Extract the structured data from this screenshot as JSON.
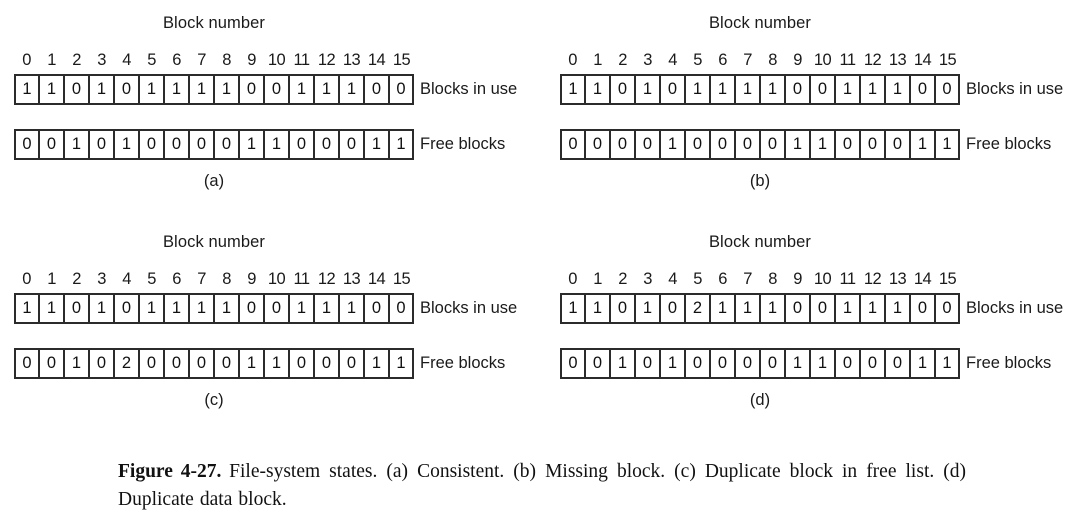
{
  "figure": {
    "caption_number": "Figure 4-27.",
    "caption_text": "File-system states.  (a) Consistent.  (b) Missing block.  (c) Duplicate block in free list.  (d) Duplicate data block.",
    "block_number_title": "Block number",
    "index_labels": [
      "0",
      "1",
      "2",
      "3",
      "4",
      "5",
      "6",
      "7",
      "8",
      "9",
      "10",
      "11",
      "12",
      "13",
      "14",
      "15"
    ],
    "row_labels": {
      "in_use": "Blocks in use",
      "free": "Free blocks"
    }
  },
  "panels": [
    {
      "id": "a",
      "sub_caption": "(a)",
      "title": "Block number",
      "blocks_in_use": [
        "1",
        "1",
        "0",
        "1",
        "0",
        "1",
        "1",
        "1",
        "1",
        "0",
        "0",
        "1",
        "1",
        "1",
        "0",
        "0"
      ],
      "free_blocks": [
        "0",
        "0",
        "1",
        "0",
        "1",
        "0",
        "0",
        "0",
        "0",
        "1",
        "1",
        "0",
        "0",
        "0",
        "1",
        "1"
      ],
      "in_use_label": "Blocks in use",
      "free_label": "Free blocks"
    },
    {
      "id": "b",
      "sub_caption": "(b)",
      "title": "Block number",
      "blocks_in_use": [
        "1",
        "1",
        "0",
        "1",
        "0",
        "1",
        "1",
        "1",
        "1",
        "0",
        "0",
        "1",
        "1",
        "1",
        "0",
        "0"
      ],
      "free_blocks": [
        "0",
        "0",
        "0",
        "0",
        "1",
        "0",
        "0",
        "0",
        "0",
        "1",
        "1",
        "0",
        "0",
        "0",
        "1",
        "1"
      ],
      "in_use_label": "Blocks in use",
      "free_label": "Free blocks"
    },
    {
      "id": "c",
      "sub_caption": "(c)",
      "title": "Block number",
      "blocks_in_use": [
        "1",
        "1",
        "0",
        "1",
        "0",
        "1",
        "1",
        "1",
        "1",
        "0",
        "0",
        "1",
        "1",
        "1",
        "0",
        "0"
      ],
      "free_blocks": [
        "0",
        "0",
        "1",
        "0",
        "2",
        "0",
        "0",
        "0",
        "0",
        "1",
        "1",
        "0",
        "0",
        "0",
        "1",
        "1"
      ],
      "in_use_label": "Blocks in use",
      "free_label": "Free blocks"
    },
    {
      "id": "d",
      "sub_caption": "(d)",
      "title": "Block number",
      "blocks_in_use": [
        "1",
        "1",
        "0",
        "1",
        "0",
        "2",
        "1",
        "1",
        "1",
        "0",
        "0",
        "1",
        "1",
        "1",
        "0",
        "0"
      ],
      "free_blocks": [
        "0",
        "0",
        "1",
        "0",
        "1",
        "0",
        "0",
        "0",
        "0",
        "1",
        "1",
        "0",
        "0",
        "0",
        "1",
        "1"
      ],
      "in_use_label": "Blocks in use",
      "free_label": "Free blocks"
    }
  ]
}
